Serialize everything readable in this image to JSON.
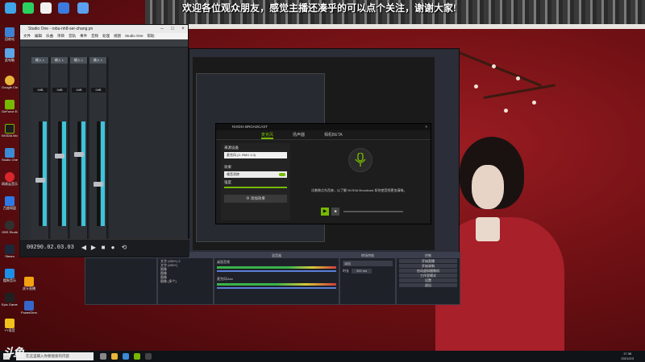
{
  "banner": {
    "text": "欢迎各位观众朋友，感觉主播还凑乎的可以点个关注，谢谢大家!"
  },
  "studio": {
    "title": "Studio One - robu-nh8-ser-zhang.pn",
    "menu": [
      "文件",
      "编辑",
      "乐曲",
      "项目",
      "音轨",
      "事件",
      "音频",
      "处理",
      "视图",
      "Studio One",
      "帮助"
    ],
    "channels": [
      {
        "name": "输入 L",
        "vol": "0dB"
      },
      {
        "name": "输入 L",
        "vol": "0dB"
      },
      {
        "name": "输入 L",
        "vol": "0dB"
      },
      {
        "name": "输入 L",
        "vol": "0dB"
      }
    ],
    "time": "00290.02.03.03"
  },
  "nvidia": {
    "title": "NVIDIA BROADCAST",
    "tabs": [
      "麦克风",
      "扬声器",
      "相机BETA"
    ],
    "source_label": "来源设备",
    "source_value": "麦克风 (2- RMV 1.0)",
    "effect_label": "效果",
    "effect_value": "噪音消除",
    "strength_label": "强度",
    "add_effect": "添加效果",
    "description": "试着做点东西来，以了解 NVIDIA Broadcast 如何使音频更加清晰。"
  },
  "obs": {
    "docks": [
      "场景",
      "来源",
      "混音器",
      "转场特效",
      "控制"
    ],
    "sources": [
      "文字 (GDI+) 2",
      "文字 (GDI+)",
      "图像",
      "图像",
      "图像",
      "图像 (多个)"
    ],
    "mixer_tracks": [
      "桌面音频",
      "麦克风/Aux"
    ],
    "transition": "淡出",
    "duration_label": "时长",
    "duration_value": "300 ms",
    "controls": [
      "开始直播",
      "开始录制",
      "启动虚拟摄像机",
      "工作室模式",
      "设置",
      "退出"
    ]
  },
  "desktop_icons": [
    "回收站",
    "此电脑",
    "Google Chrome",
    "GeForce Experience",
    "NVIDIA Broadcast",
    "Studio One",
    "网易云音乐",
    "百度网盘",
    "OBS Studio",
    "Steam",
    "酷狗音乐",
    "Epic Games Launcher",
    "YY语音",
    "虎牙直播",
    "PowerDirector"
  ],
  "taskbar": {
    "search_placeholder": "在这里输入你要搜索的内容",
    "time": "17:38",
    "date": "2021/2/3"
  },
  "watermark": "斗鱼"
}
